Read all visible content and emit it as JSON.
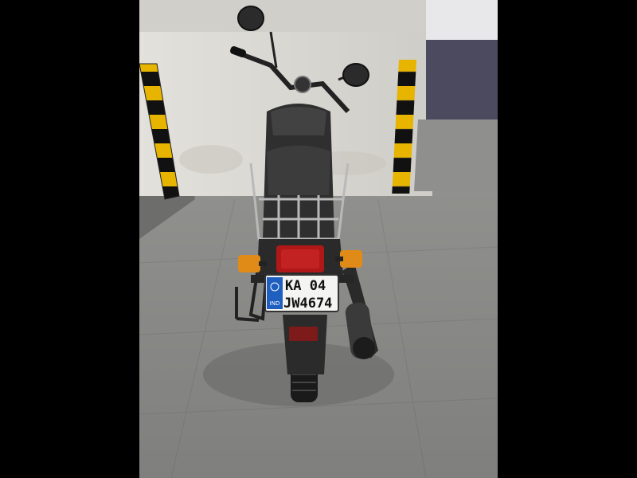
{
  "photo": {
    "subject": "Motorcycle parked in a garage, rear view",
    "plate": {
      "country_badge": "IND",
      "line1": "KA 04",
      "line2": "JW4674"
    },
    "colors": {
      "letterbox": "#000000",
      "wall": "#d8d6d0",
      "floor": "#8c8c8a",
      "pillar_yellow": "#e7b400",
      "pillar_black": "#111111",
      "badge_blue": "#1f5fbf",
      "tail_lamp": "#b01818",
      "indicator": "#e08a18"
    }
  }
}
